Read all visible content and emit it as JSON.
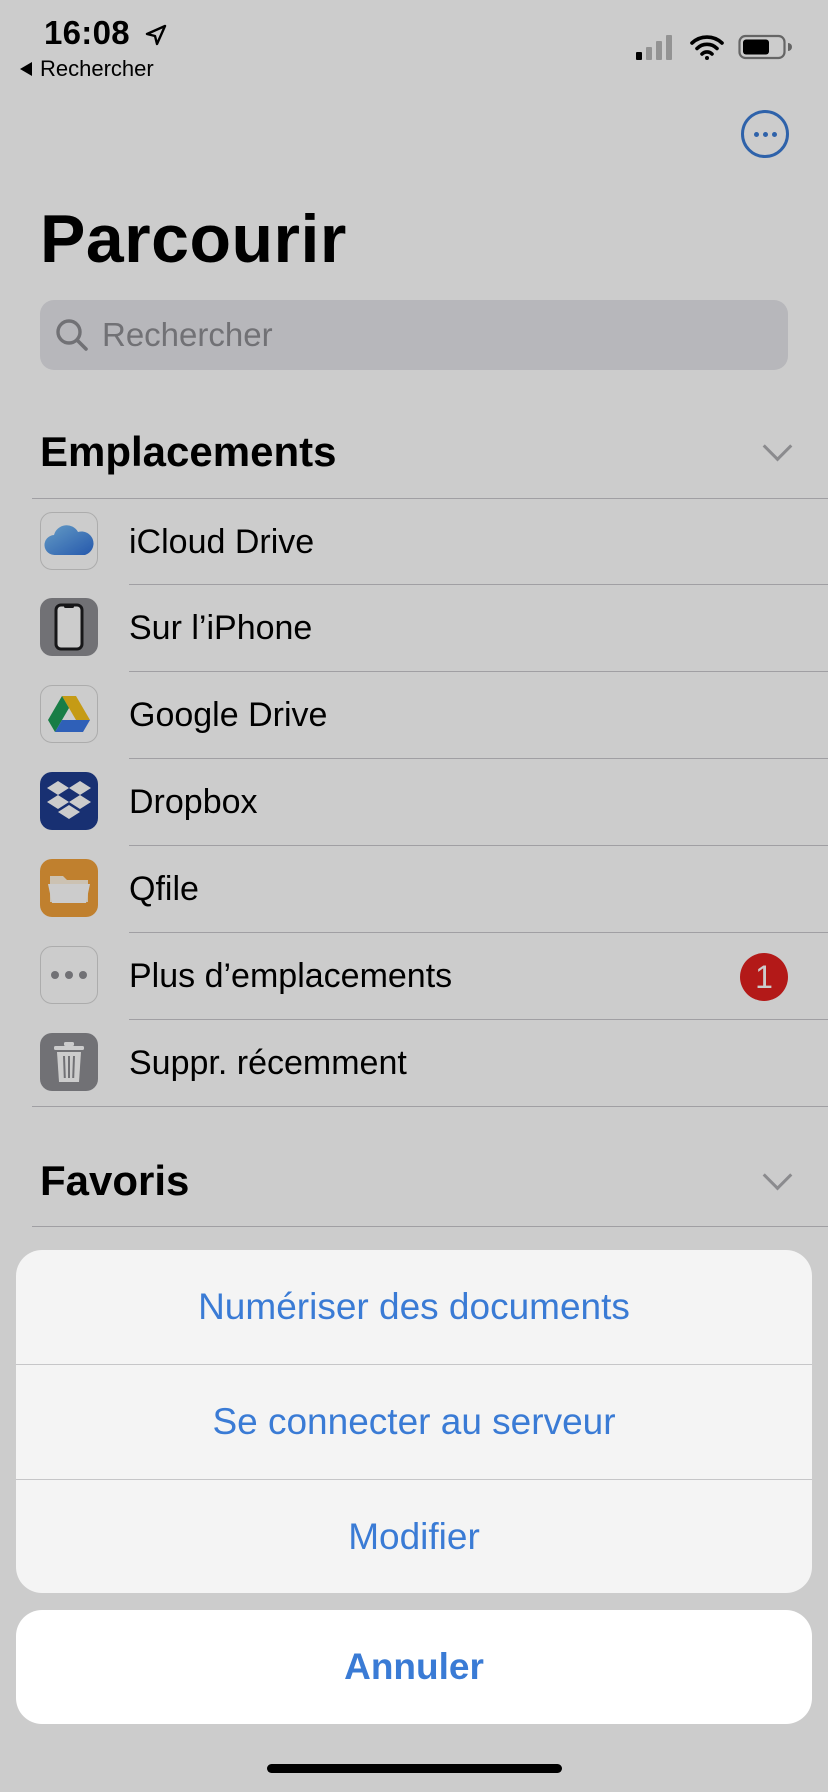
{
  "status_bar": {
    "time": "16:08",
    "back_label": "Rechercher"
  },
  "header": {
    "title": "Parcourir",
    "search_placeholder": "Rechercher"
  },
  "locations": {
    "title": "Emplacements",
    "items": [
      {
        "label": "iCloud Drive",
        "icon": "icloud-drive-icon"
      },
      {
        "label": "Sur l’iPhone",
        "icon": "iphone-icon"
      },
      {
        "label": "Google Drive",
        "icon": "google-drive-icon"
      },
      {
        "label": "Dropbox",
        "icon": "dropbox-icon"
      },
      {
        "label": "Qfile",
        "icon": "qfile-folder-icon"
      },
      {
        "label": "Plus d’emplacements",
        "icon": "more-dots-icon",
        "badge": "1"
      },
      {
        "label": "Suppr. récemment",
        "icon": "trash-icon"
      }
    ]
  },
  "favorites": {
    "title": "Favoris"
  },
  "action_sheet": {
    "items": [
      "Numériser des documents",
      "Se connecter au serveur",
      "Modifier"
    ],
    "cancel": "Annuler"
  },
  "colors": {
    "accent": "#3a7bd5",
    "badge": "#e0201e"
  }
}
